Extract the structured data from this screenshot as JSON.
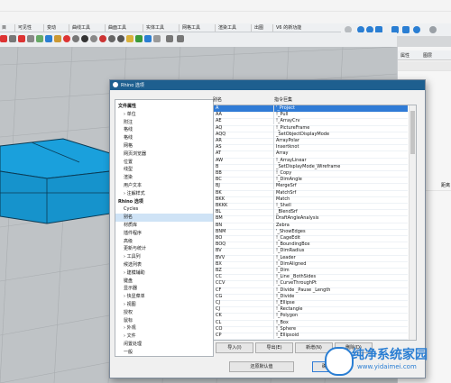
{
  "menu_tabs": [
    "目",
    "可见性",
    "变动",
    "曲线工具",
    "曲面工具",
    "实体工具",
    "网格工具",
    "渲染工具",
    "出图",
    "V6 的新功能"
  ],
  "right_panel": {
    "tabs": [
      "属性",
      "图层"
    ],
    "rows": [
      "",
      "",
      "",
      "",
      "",
      "",
      "",
      "",
      "",
      "",
      "",
      "",
      "",
      "",
      "",
      "",
      "",
      "",
      "",
      ""
    ],
    "row_tail": "距离"
  },
  "dialog": {
    "title": "Rhino 选项",
    "tree": [
      {
        "label": "文件属性",
        "bold": true,
        "indent": 0
      },
      {
        "label": "单位",
        "bold": false,
        "indent": 1,
        "arrow": "›"
      },
      {
        "label": "附注",
        "bold": false,
        "indent": 1
      },
      {
        "label": "格线",
        "bold": false,
        "indent": 1
      },
      {
        "label": "格线",
        "bold": false,
        "indent": 1
      },
      {
        "label": "网格",
        "bold": false,
        "indent": 1
      },
      {
        "label": "网页浏览器",
        "bold": false,
        "indent": 1
      },
      {
        "label": "位置",
        "bold": false,
        "indent": 1
      },
      {
        "label": "线型",
        "bold": false,
        "indent": 1
      },
      {
        "label": "渲染",
        "bold": false,
        "indent": 1
      },
      {
        "label": "用户文本",
        "bold": false,
        "indent": 1
      },
      {
        "label": "注解样式",
        "bold": false,
        "indent": 1,
        "arrow": "›"
      },
      {
        "label": "Rhino 选项",
        "bold": true,
        "indent": 0
      },
      {
        "label": "Cycles",
        "bold": false,
        "indent": 1
      },
      {
        "label": "别名",
        "bold": false,
        "indent": 1,
        "selected": true
      },
      {
        "label": "材质库",
        "bold": false,
        "indent": 1
      },
      {
        "label": "插件程序",
        "bold": false,
        "indent": 1
      },
      {
        "label": "高级",
        "bold": false,
        "indent": 1
      },
      {
        "label": "更新与统计",
        "bold": false,
        "indent": 1
      },
      {
        "label": "工具列",
        "bold": false,
        "indent": 1,
        "arrow": "›"
      },
      {
        "label": "候选列表",
        "bold": false,
        "indent": 1
      },
      {
        "label": "建模辅助",
        "bold": false,
        "indent": 1,
        "arrow": "›"
      },
      {
        "label": "键盘",
        "bold": false,
        "indent": 1
      },
      {
        "label": "显示器",
        "bold": false,
        "indent": 1
      },
      {
        "label": "快显菜单",
        "bold": false,
        "indent": 1,
        "arrow": "›"
      },
      {
        "label": "视图",
        "bold": false,
        "indent": 1,
        "arrow": "›"
      },
      {
        "label": "授权",
        "bold": false,
        "indent": 1
      },
      {
        "label": "鼠标",
        "bold": false,
        "indent": 1
      },
      {
        "label": "外观",
        "bold": false,
        "indent": 1,
        "arrow": "›"
      },
      {
        "label": "文件",
        "bold": false,
        "indent": 1,
        "arrow": "›"
      },
      {
        "label": "闲置处理",
        "bold": false,
        "indent": 1
      },
      {
        "label": "一般",
        "bold": false,
        "indent": 1
      }
    ],
    "col_alias": "别名",
    "col_macro": "指令巨集",
    "aliases": [
      [
        "A",
        "'_Project"
      ],
      [
        "AA",
        "!_Pull"
      ],
      [
        "AE",
        "!_ArrayCrv"
      ],
      [
        "AQ",
        "!_PictureFrame"
      ],
      [
        "AQQ",
        "_SetObjectDisplayMode"
      ],
      [
        "AR",
        "ArrayPolar"
      ],
      [
        "AS",
        "Insertknot"
      ],
      [
        "AT",
        "Array"
      ],
      [
        "AW",
        "!_ArrayLinear"
      ],
      [
        "B",
        "_SetDisplayMode_Wireframe"
      ],
      [
        "BB",
        "!_Copy"
      ],
      [
        "BC",
        "!_DimAngle"
      ],
      [
        "BJ",
        "MergeSrf"
      ],
      [
        "BK",
        "MatchSrf"
      ],
      [
        "BKK",
        "Match"
      ],
      [
        "BKKK",
        "!_Shell"
      ],
      [
        "BL",
        "_BlendSrf"
      ],
      [
        "BM",
        "DraftAngleAnalysis"
      ],
      [
        "BN",
        "Zebra"
      ],
      [
        "BNM",
        "'_ShowEdges"
      ],
      [
        "BO",
        "!_CageEdit"
      ],
      [
        "BOQ",
        "!_BoundingBox"
      ],
      [
        "BV",
        "!_DimRadius"
      ],
      [
        "BVV",
        "!_Leader"
      ],
      [
        "BX",
        "!_DimAligned"
      ],
      [
        "BZ",
        "!_Dim"
      ],
      [
        "CC",
        "!_Line _BothSides"
      ],
      [
        "CCV",
        "!_CurveThroughPt"
      ],
      [
        "CF",
        "!_Divide _Pause _Length"
      ],
      [
        "CG",
        "!_Divide"
      ],
      [
        "CJ",
        "!_Ellipse"
      ],
      [
        "CJ",
        "!_Rectangle"
      ],
      [
        "CK",
        "!_Polygon"
      ],
      [
        "CL",
        "!_Box"
      ],
      [
        "CO",
        "!_Sphere"
      ],
      [
        "CP",
        "!_Ellipsoid"
      ]
    ],
    "buttons": {
      "import": "导入(I)",
      "export": "导出(E)",
      "new": "新增(N)",
      "delete": "删除(D)"
    },
    "restore": "还原默认值",
    "ok": "确定"
  },
  "watermark": {
    "line1": "纯净系统家园",
    "line2": "www.yidaimei.com"
  },
  "colors": {
    "title_bar": "#1e5f8f",
    "selection": "#2f7bd6",
    "box": "#1e9fd6"
  }
}
